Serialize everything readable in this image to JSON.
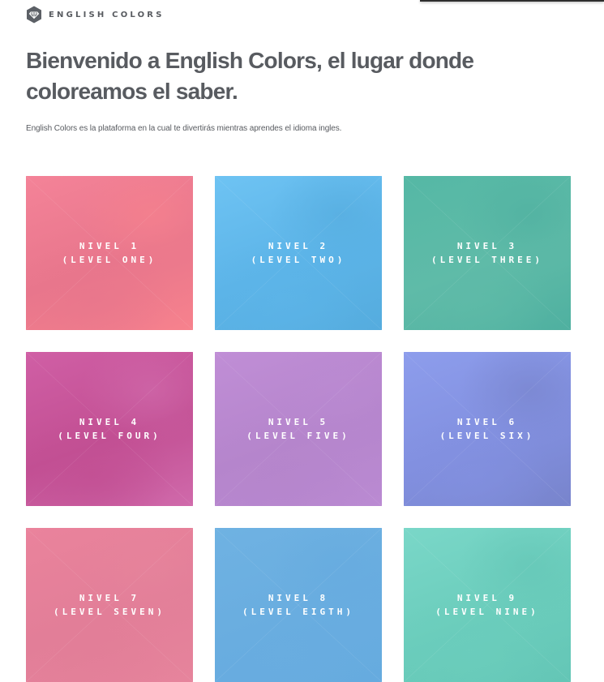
{
  "brand": {
    "name": "ENGLISH COLORS",
    "logo_icon": "diamond-gem-icon"
  },
  "headline": "Bienvenido a English Colors, el lugar donde coloreamos el saber.",
  "intro": "English Colors es la plataforma en la cual te divertirás mientras aprendes el idioma ingles.",
  "levels": [
    {
      "line1": "NIVEL 1",
      "line2": "(LEVEL ONE)",
      "colors": [
        "#f48398",
        "#e8768c",
        "#f7828d"
      ]
    },
    {
      "line1": "NIVEL 2",
      "line2": "(LEVEL TWO)",
      "colors": [
        "#6ec3f3",
        "#5cb4e8",
        "#55acde"
      ]
    },
    {
      "line1": "NIVEL 3",
      "line2": "(LEVEL THREE)",
      "colors": [
        "#55b8a5",
        "#5fbba8",
        "#4fb0a0"
      ]
    },
    {
      "line1": "NIVEL 4",
      "line2": "(LEVEL FOUR)",
      "colors": [
        "#d05fa5",
        "#c24f93",
        "#d06aab"
      ]
    },
    {
      "line1": "NIVEL 5",
      "line2": "(LEVEL FIVE)",
      "colors": [
        "#c08ed6",
        "#b585cc",
        "#ba8ad2"
      ]
    },
    {
      "line1": "NIVEL 6",
      "line2": "(LEVEL SIX)",
      "colors": [
        "#8d9dec",
        "#8290e0",
        "#7884cc"
      ]
    },
    {
      "line1": "NIVEL 7",
      "line2": "(LEVEL SEVEN)",
      "colors": [
        "#ea839c",
        "#e27e98",
        "#e6849c"
      ]
    },
    {
      "line1": "NIVEL 8",
      "line2": "(LEVEL EIGTH)",
      "colors": [
        "#6fb2e2",
        "#69ade0",
        "#66abdf"
      ]
    },
    {
      "line1": "NIVEL 9",
      "line2": "(LEVEL NINE)",
      "colors": [
        "#7ad7c8",
        "#6bcdbc",
        "#64c6b6"
      ]
    }
  ]
}
